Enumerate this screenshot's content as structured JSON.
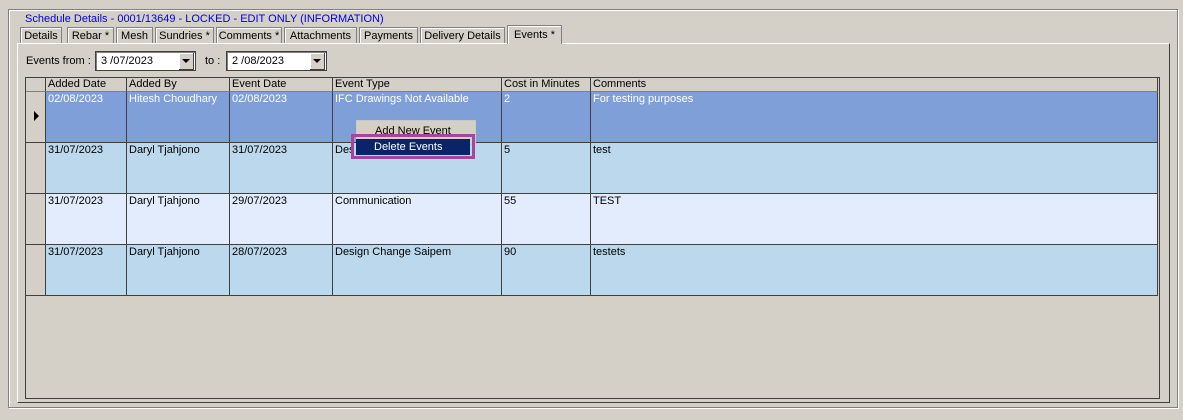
{
  "window": {
    "title": "Schedule Details - 0001/13649 - LOCKED - EDIT ONLY (INFORMATION)"
  },
  "tabs": [
    {
      "label": "Details"
    },
    {
      "label": "Rebar *"
    },
    {
      "label": "Mesh"
    },
    {
      "label": "Sundries *"
    },
    {
      "label": "Comments *"
    },
    {
      "label": "Attachments"
    },
    {
      "label": "Payments"
    },
    {
      "label": "Delivery Details"
    },
    {
      "label": "Events *",
      "active": true
    }
  ],
  "filter": {
    "from_label": "Events from :",
    "from_value": "3 /07/2023",
    "to_label": "to :",
    "to_value": "2 /08/2023"
  },
  "grid": {
    "columns": [
      "Added Date",
      "Added By",
      "Event Date",
      "Event Type",
      "Cost in Minutes",
      "Comments"
    ],
    "rows": [
      {
        "added_date": "02/08/2023",
        "added_by": "Hitesh Choudhary",
        "event_date": "02/08/2023",
        "event_type": "IFC Drawings Not Available",
        "cost": "2",
        "comments": "For testing purposes"
      },
      {
        "added_date": "31/07/2023",
        "added_by": "Daryl Tjahjono",
        "event_date": "31/07/2023",
        "event_type": "Des",
        "cost": "5",
        "comments": "test"
      },
      {
        "added_date": "31/07/2023",
        "added_by": "Daryl Tjahjono",
        "event_date": "29/07/2023",
        "event_type": "Communication",
        "cost": "55",
        "comments": "TEST"
      },
      {
        "added_date": "31/07/2023",
        "added_by": "Daryl Tjahjono",
        "event_date": "28/07/2023",
        "event_type": "Design Change Saipem",
        "cost": "90",
        "comments": "testets"
      }
    ],
    "selected_row": 0
  },
  "context_menu": {
    "items": [
      "Add New Event",
      "Delete Events"
    ],
    "highlighted": "Delete Events"
  },
  "colors": {
    "selected_row": "#7f9fd9",
    "row_alt_a": "#bcd8ec",
    "row_alt_b": "#e2ecfc",
    "highlight_box": "#a3469d",
    "menu_selected": "#0a246a",
    "title_blue": "#0000e0"
  }
}
